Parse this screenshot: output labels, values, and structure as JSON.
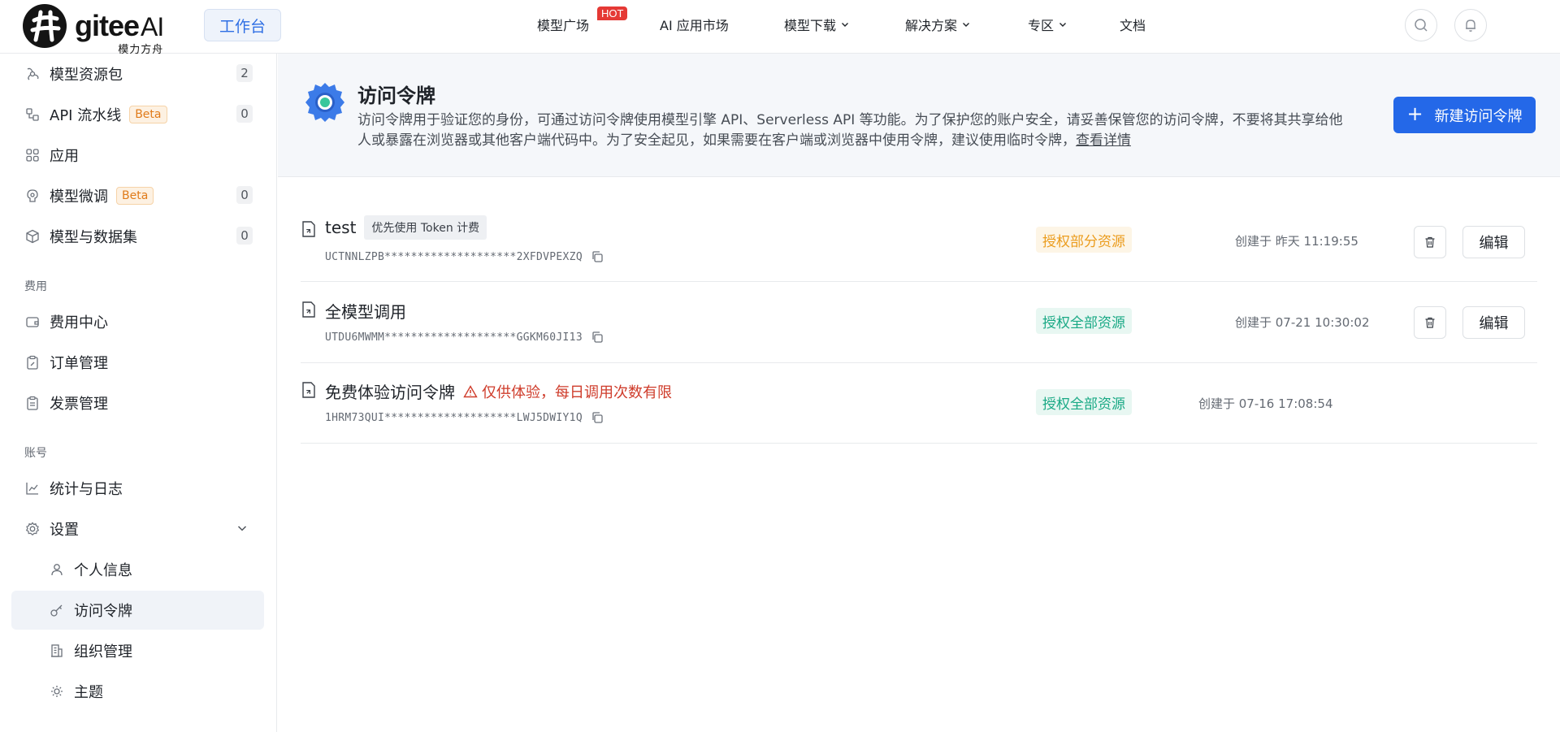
{
  "header": {
    "logo_text": "gitee",
    "logo_ai": "AI",
    "logo_subtitle": "模力方舟",
    "workbench_label": "工作台",
    "nav": [
      {
        "label": "模型广场",
        "badge": "HOT",
        "has_dropdown": false
      },
      {
        "label": "AI 应用市场",
        "has_dropdown": false
      },
      {
        "label": "模型下载",
        "has_dropdown": true
      },
      {
        "label": "解决方案",
        "has_dropdown": true
      },
      {
        "label": "专区",
        "has_dropdown": true
      },
      {
        "label": "文档",
        "has_dropdown": false
      }
    ],
    "search_icon": "search-icon",
    "notification_icon": "bell-icon"
  },
  "sidebar": {
    "items": [
      {
        "label": "模型资源包",
        "count": "2",
        "icon": "resource-pack-icon"
      },
      {
        "label": "API 流水线",
        "badge": "Beta",
        "count": "0",
        "icon": "pipeline-icon"
      },
      {
        "label": "应用",
        "icon": "apps-grid-icon"
      },
      {
        "label": "模型微调",
        "badge": "Beta",
        "count": "0",
        "icon": "fine-tune-icon"
      },
      {
        "label": "模型与数据集",
        "count": "0",
        "icon": "cube-icon"
      }
    ],
    "billing_section": "费用",
    "billing_items": [
      {
        "label": "费用中心",
        "icon": "wallet-icon"
      },
      {
        "label": "订单管理",
        "icon": "clipboard-edit-icon"
      },
      {
        "label": "发票管理",
        "icon": "clipboard-icon"
      }
    ],
    "account_section": "账号",
    "account_items": [
      {
        "label": "统计与日志",
        "icon": "line-chart-icon"
      },
      {
        "label": "设置",
        "icon": "gear-icon",
        "expanded": true
      }
    ],
    "settings_items": [
      {
        "label": "个人信息",
        "icon": "user-icon"
      },
      {
        "label": "访问令牌",
        "icon": "key-icon",
        "active": true
      },
      {
        "label": "组织管理",
        "icon": "building-icon"
      },
      {
        "label": "主题",
        "icon": "sun-icon"
      }
    ]
  },
  "banner": {
    "title": "访问令牌",
    "description": "访问令牌用于验证您的身份，可通过访问令牌使用模型引擎 API、Serverless API 等功能。为了保护您的账户安全，请妥善保管您的访问令牌，不要将其共享给他人或暴露在浏览器或其他客户端代码中。为了安全起见，如果需要在客户端或浏览器中使用令牌，建议使用临时令牌，",
    "link": "查看详情",
    "new_button": "新建访问令牌"
  },
  "tokens": [
    {
      "name": "test",
      "tag": "优先使用 Token 计费",
      "key": "UCTNNLZPB********************2XFDVPEXZQ",
      "scope": "授权部分资源",
      "scope_type": "partial",
      "created": "创建于 昨天 11:19:55",
      "edit_label": "编辑"
    },
    {
      "name": "全模型调用",
      "key": "UTDU6MWMM********************GGKM60JI13",
      "scope": "授权全部资源",
      "scope_type": "full",
      "created": "创建于 07-21 10:30:02",
      "edit_label": "编辑"
    },
    {
      "name": "免费体验访问令牌",
      "warning": "仅供体验，每日调用次数有限",
      "key": "1HRM73QUI********************LWJ5DWIY1Q",
      "scope": "授权全部资源",
      "scope_type": "full",
      "created": "创建于 07-16 17:08:54"
    }
  ],
  "colors": {
    "primary": "#2468e8",
    "partial_scope": "#eb9c1d",
    "full_scope": "#19a985",
    "warning": "#cf3c2b"
  }
}
